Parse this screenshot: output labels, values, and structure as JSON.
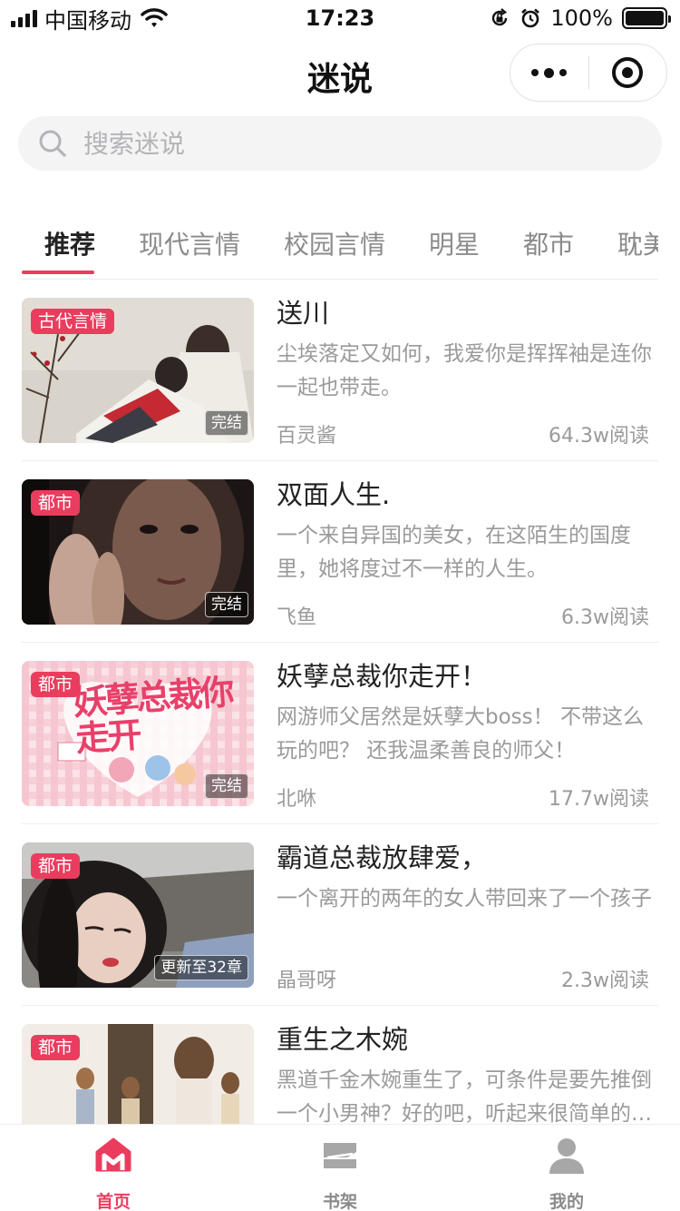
{
  "status_bar": {
    "carrier": "中国移动",
    "time": "17:23",
    "battery": "100%",
    "battery_level": 1.0
  },
  "nav": {
    "title": "迷说"
  },
  "search": {
    "placeholder": "搜索迷说",
    "value": ""
  },
  "tabs": [
    {
      "label": "推荐",
      "active": true
    },
    {
      "label": "现代言情",
      "active": false
    },
    {
      "label": "校园言情",
      "active": false
    },
    {
      "label": "明星",
      "active": false
    },
    {
      "label": "都市",
      "active": false
    },
    {
      "label": "耽美",
      "active": false
    }
  ],
  "books": [
    {
      "title": "送川",
      "category": "古代言情",
      "status": "完结",
      "desc": "尘埃落定又如何，我爱你是挥挥袖是连你一起也带走。",
      "author": "百灵酱",
      "reads": "64.3w阅读"
    },
    {
      "title": "双面人生.",
      "category": "都市",
      "status": "完结",
      "desc": "一个来自异国的美女，在这陌生的国度里，她将度过不一样的人生。",
      "author": "飞鱼",
      "reads": "6.3w阅读"
    },
    {
      "title": "妖孽总裁你走开！",
      "category": "都市",
      "status": "完结",
      "desc": "网游师父居然是妖孽大boss！ 不带这么玩的吧？ 还我温柔善良的师父！",
      "author": "北咻",
      "reads": "17.7w阅读"
    },
    {
      "title": "霸道总裁放肆爱，",
      "category": "都市",
      "status": "更新至32章",
      "desc": "一个离开的两年的女人带回来了一个孩子",
      "author": "晶哥呀",
      "reads": "2.3w阅读"
    },
    {
      "title": "重生之木婉",
      "category": "都市",
      "status": "",
      "desc": "黑道千金木婉重生了，可条件是要先推倒一个小男神？好的吧，听起来很简单的样子",
      "author": "",
      "reads": ""
    }
  ],
  "cover_art": {
    "book3_title_art": "妖孽总裁你走开"
  },
  "tabbar": [
    {
      "label": "首页",
      "icon": "home-icon",
      "active": true
    },
    {
      "label": "书架",
      "icon": "bookshelf-icon",
      "active": false
    },
    {
      "label": "我的",
      "icon": "profile-icon",
      "active": false
    }
  ],
  "colors": {
    "accent": "#ea3d5e",
    "text_primary": "#222222",
    "text_secondary": "#9a9a9a",
    "icon_gray": "#a7a7a7"
  }
}
